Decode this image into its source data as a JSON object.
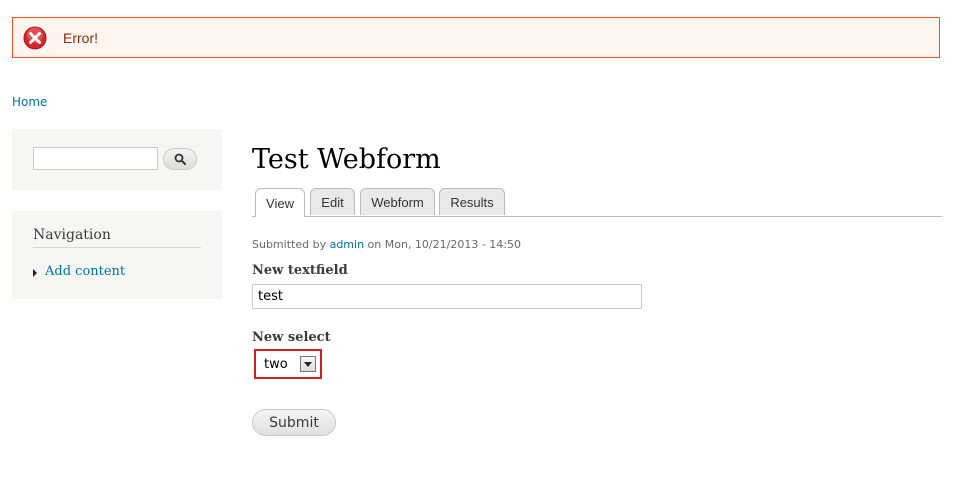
{
  "messages": {
    "error_text": "Error!"
  },
  "breadcrumb": {
    "home": "Home"
  },
  "search": {
    "value": "",
    "placeholder": ""
  },
  "navigation": {
    "title": "Navigation",
    "items": [
      {
        "label": "Add content"
      }
    ]
  },
  "page": {
    "title": "Test Webform"
  },
  "tabs": [
    {
      "label": "View",
      "active": true
    },
    {
      "label": "Edit",
      "active": false
    },
    {
      "label": "Webform",
      "active": false
    },
    {
      "label": "Results",
      "active": false
    }
  ],
  "submitted": {
    "prefix": "Submitted by",
    "author": "admin",
    "suffix": "on Mon, 10/21/2013 - 14:50"
  },
  "form": {
    "textfield_label": "New textfield",
    "textfield_value": "test",
    "select_label": "New select",
    "select_value": "two",
    "submit_label": "Submit"
  },
  "colors": {
    "error_border": "#ed541d",
    "error_bg": "#fef5f1",
    "error_text": "#8c2e0b",
    "link": "#0071b3",
    "select_error": "#d61f26"
  },
  "icons": {
    "error": "error-circle-x-icon",
    "search": "search-icon",
    "bullet": "triangle-right-icon",
    "select": "chevron-down-icon"
  }
}
